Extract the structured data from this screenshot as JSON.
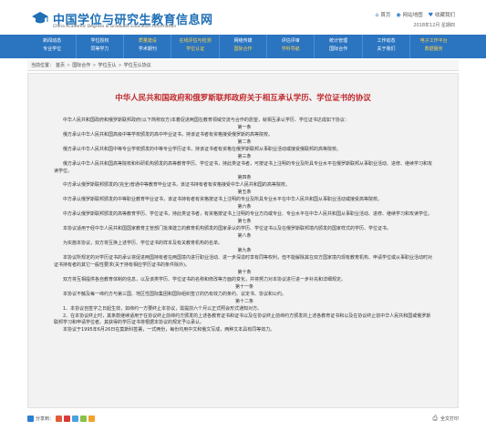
{
  "header": {
    "title": "中国学位与研究生教育信息网",
    "subtitle": "China Academic Degrees & Graduate Education Information",
    "links": [
      {
        "label": "首页",
        "icon": "home-icon"
      },
      {
        "label": "网站地图",
        "icon": "sitemap-icon"
      },
      {
        "label": "收藏我们",
        "icon": "bookmark-icon"
      }
    ],
    "date": "2018年12月 星期四"
  },
  "nav": [
    {
      "top": "新闻动态",
      "bottom": "专业学位",
      "top_hl": false,
      "bot_hl": false
    },
    {
      "top": "学位授权",
      "bottom": "同等学力",
      "top_hl": false,
      "bot_hl": false
    },
    {
      "top": "质量建设",
      "bottom": "学术期刊",
      "top_hl": true,
      "bot_hl": false
    },
    {
      "top": "在线评估与检测",
      "bottom": "学位认证",
      "top_hl": true,
      "bot_hl": true
    },
    {
      "top": "网络传媒",
      "bottom": "国际合作",
      "top_hl": false,
      "bot_hl": true
    },
    {
      "top": "评估评审",
      "bottom": "学科导航",
      "top_hl": false,
      "bot_hl": true
    },
    {
      "top": "统计管理",
      "bottom": "国际合作",
      "top_hl": false,
      "bot_hl": false
    },
    {
      "top": "工作动态",
      "bottom": "关于我们",
      "top_hl": false,
      "bot_hl": false
    },
    {
      "top": "电子工作平台",
      "bottom": "数据服务",
      "top_hl": true,
      "bot_hl": true
    }
  ],
  "breadcrumb": {
    "prefix": "当前位置：",
    "items": [
      "首页",
      "国际合作",
      "学位互认",
      "学位互认协议"
    ]
  },
  "doc": {
    "title": "中华人民共和国政府和俄罗斯联邦政府关于相互承认学历、学位证书的协议",
    "paragraphs": [
      {
        "type": "p",
        "text": "中华人民共和国政府和俄罗斯联邦政府(以下简称双方)本着促进两国在教育领域交流与合作的愿望，就相互承认学历、学位证书达成如下协议："
      },
      {
        "type": "art",
        "text": "第一条"
      },
      {
        "type": "p",
        "text": "俄方承认中华人民共和国高级中等学校颁发的高中毕业证书，持该证书者有资格接受俄罗斯的高等院校。"
      },
      {
        "type": "art",
        "text": "第二条"
      },
      {
        "type": "p",
        "text": "俄方承认中华人民共和国中等专业学校颁发的中等专业学历证书，持该证书者有资格在俄罗斯联邦从事职业活动或接受俄联邦的高等院校。"
      },
      {
        "type": "art",
        "text": "第三条"
      },
      {
        "type": "p",
        "text": "俄方承认中华人民共和国高等院校和科研机构颁发的高等教育学历、学位证书，持此类证书者，可按证书上注明的专业及所具专业水平在俄罗斯联邦从事职业活动、进修、继续学习和攻读学位。"
      },
      {
        "type": "art",
        "text": "第四条"
      },
      {
        "type": "p",
        "text": "中方承认俄罗斯联邦颁发的(完全)普通中等教育毕业证书，该证书持有者有资格接受中华人民共和国的高等院校。"
      },
      {
        "type": "art",
        "text": "第五条"
      },
      {
        "type": "p",
        "text": "中方承认俄罗斯联邦颁发的中等职业教育毕业证书，该证书持有者有资格按证书上注明的专业及所具专业水平在中华人民共和国从事职业活动或接受高等院校。"
      },
      {
        "type": "art",
        "text": "第六条"
      },
      {
        "type": "p",
        "text": "中方承认俄罗斯联邦颁发的高等教育学历、学位证书，持此类证书者，有资格按证书上注明的专业方向或专业、专业水平在中华人民共和国从事职业活动、进修、继续学习和攻读学位。"
      },
      {
        "type": "art",
        "text": "第七条"
      },
      {
        "type": "p",
        "text": "本协议适用于经中华人民共和国国家教育主管部门批准建立的教育机构颁发的国家承认的学历、学位证书以及在俄罗斯联邦境内颁发的国家样式的学历、学位证书。"
      },
      {
        "type": "art",
        "text": "第八条"
      },
      {
        "type": "p",
        "text": "为实施本协议，双方将互换上述学历、学位证书的样本及有关教育机构的名单。"
      },
      {
        "type": "art",
        "text": "第九条"
      },
      {
        "type": "p",
        "text": "本协议所规定的对学历证书的承认将促进两国持有者在两国境内进行职业活动、进一步深造时享有同等权利，但不能解除其在双方国家境内现有教育机构、申请学位或从事职业活动时对证书持有者的其它一般性要求(关于持有相应学历证书的条件除外)。"
      },
      {
        "type": "art",
        "text": "第十条"
      },
      {
        "type": "p",
        "text": "双方将互相提供各自教育体制的信息，以及该类学历、学位证书的名称和修改等方面的变化，并将努力对本协议进行进一步补充和详细规定。"
      },
      {
        "type": "art",
        "text": "第十一条"
      },
      {
        "type": "p",
        "text": "本协议不触及每一缔约方与第三国、地区性国际集团和国际组织签订的仍有效力的条约、议定书、协议和公约。"
      },
      {
        "type": "art",
        "text": "第十二条"
      },
      {
        "type": "p",
        "text": "1、本协议自签字之日起生效，如缔约一方要终止本协议，需提前六个月以正式照会形式通知对方。"
      },
      {
        "type": "p",
        "text": "2、在本协议终止时，其条款继续适用于在协议终止前缔约方颁发的上述各教育证书和证书以及在协议终止前缔约方颁发的上述各教育证书和以及在协议终止前中华人民共和国或俄罗斯联邦学习和申请学位者。其获得的学历证书将根据本协议的规定予以承认。"
      },
      {
        "type": "p",
        "text": "本协议于1995年6月26日在莫斯科签署，一式两份，每份均用中文和俄文写成，两种文本具有同等效力。"
      }
    ]
  },
  "footer": {
    "share_label": "分享到：",
    "print_label": "全文打印"
  }
}
